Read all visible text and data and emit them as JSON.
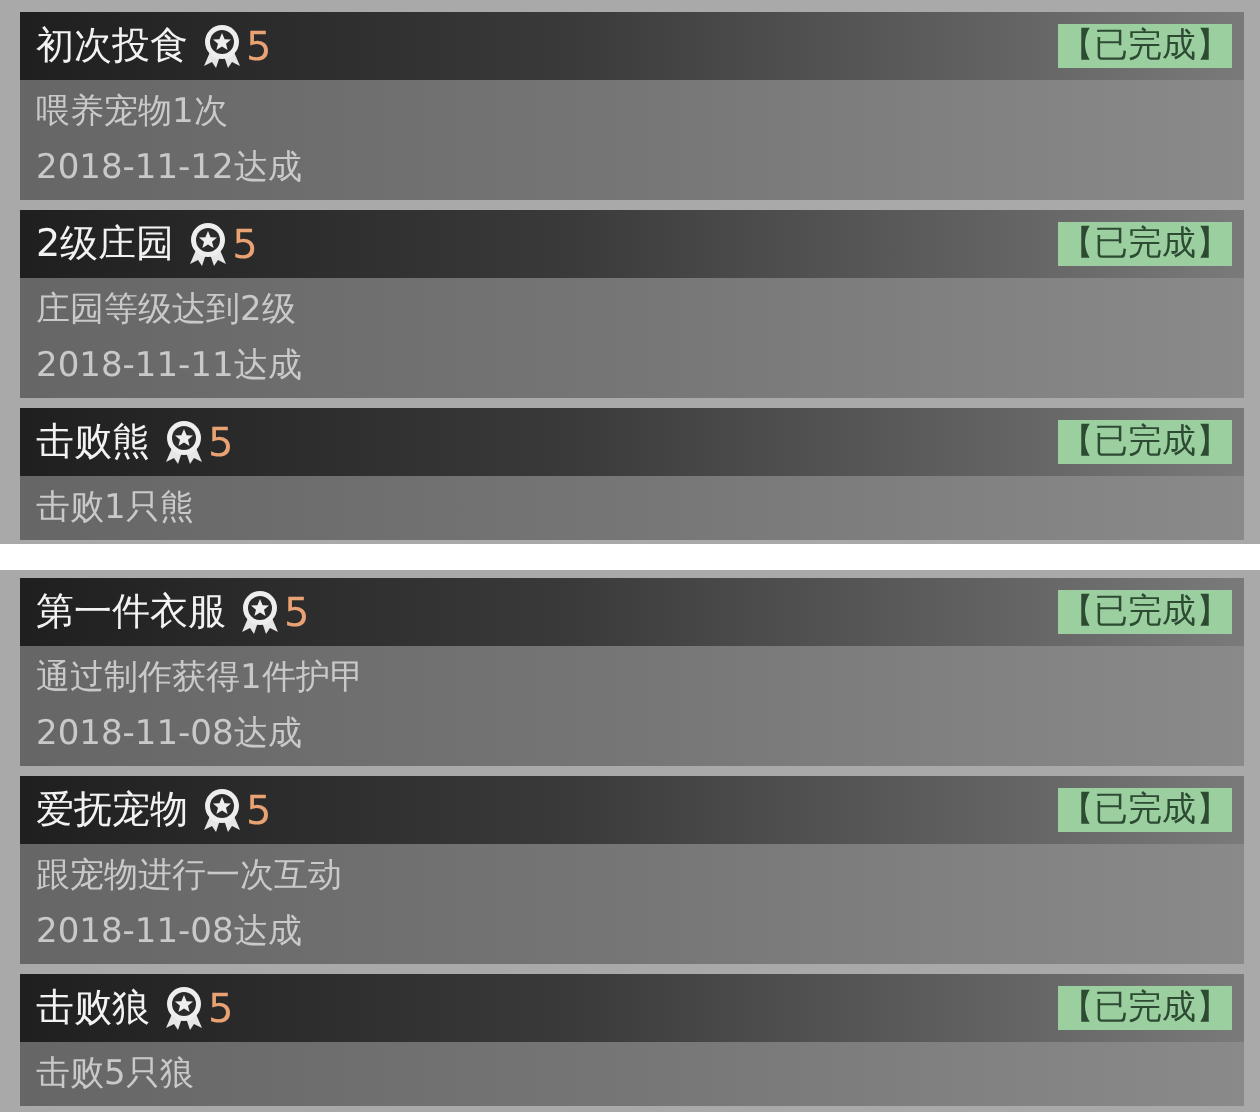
{
  "panels": [
    {
      "achievements": [
        {
          "title": "初次投食",
          "points": "5",
          "status": "【已完成】",
          "description": "喂养宠物1次",
          "date": "2018-11-12达成"
        },
        {
          "title": "2级庄园",
          "points": "5",
          "status": "【已完成】",
          "description": "庄园等级达到2级",
          "date": "2018-11-11达成"
        },
        {
          "title": "击败熊",
          "points": "5",
          "status": "【已完成】",
          "description": "击败1只熊"
        }
      ]
    },
    {
      "achievements": [
        {
          "title": "第一件衣服",
          "points": "5",
          "status": "【已完成】",
          "description": "通过制作获得1件护甲",
          "date": "2018-11-08达成"
        },
        {
          "title": "爱抚宠物",
          "points": "5",
          "status": "【已完成】",
          "description": "跟宠物进行一次互动",
          "date": "2018-11-08达成"
        },
        {
          "title": "击败狼",
          "points": "5",
          "status": "【已完成】",
          "description": "击败5只狼"
        }
      ]
    }
  ]
}
